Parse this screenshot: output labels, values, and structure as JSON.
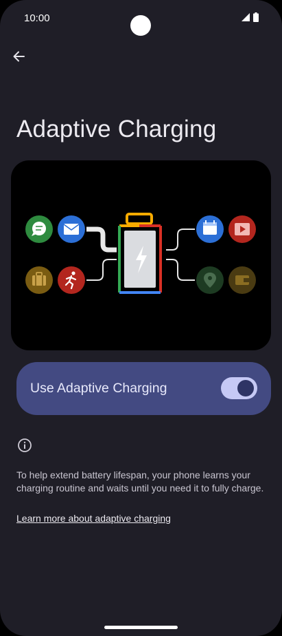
{
  "status_bar": {
    "time": "10:00"
  },
  "page": {
    "title": "Adaptive Charging"
  },
  "setting": {
    "label": "Use Adaptive Charging",
    "enabled": true
  },
  "info": {
    "description": "To help extend battery lifespan, your phone learns your charging routine and waits until you need it to fully charge.",
    "learn_more": "Learn more about adaptive charging"
  },
  "illustration": {
    "app_icons": [
      {
        "name": "messages-icon",
        "color": "#2e8b3f"
      },
      {
        "name": "email-icon",
        "color": "#2c6fd6"
      },
      {
        "name": "briefcase-icon",
        "color": "#7a5c12"
      },
      {
        "name": "fitness-icon",
        "color": "#b3261e"
      },
      {
        "name": "calendar-icon",
        "color": "#2c6fd6"
      },
      {
        "name": "video-icon",
        "color": "#b3261e"
      },
      {
        "name": "maps-icon",
        "color": "#1d3b22"
      },
      {
        "name": "wallet-icon",
        "color": "#4a3b12"
      }
    ],
    "battery_colors": [
      "#f9ab00",
      "#d93025",
      "#34a853",
      "#4285f4"
    ]
  },
  "colors": {
    "background": "#1f1e27",
    "card": "#434a82",
    "switch_track": "#c6c9f5",
    "switch_thumb": "#2e3465"
  }
}
